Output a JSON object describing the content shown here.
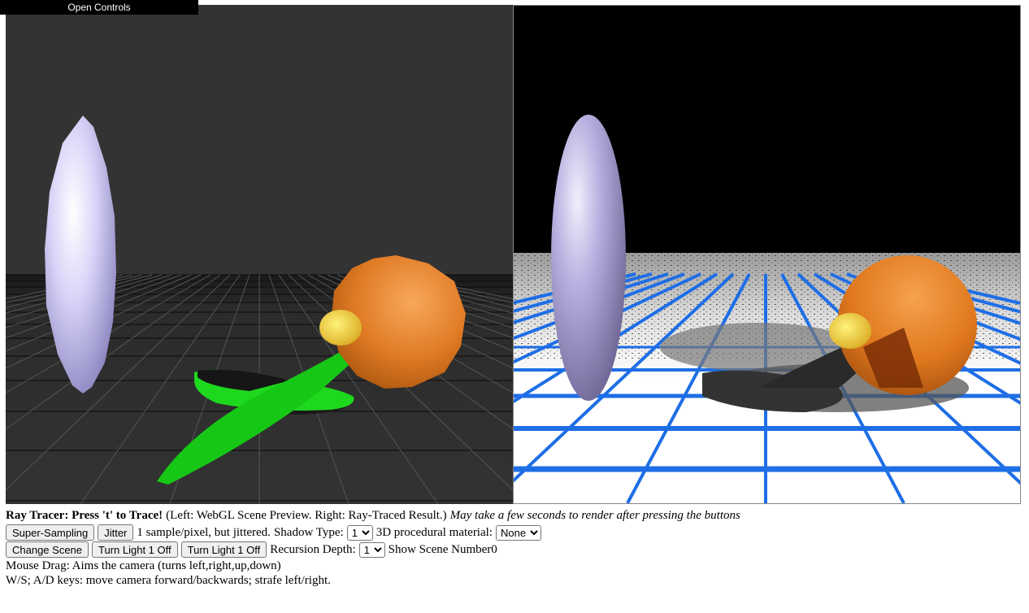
{
  "gui": {
    "open_controls_label": "Open Controls"
  },
  "header": {
    "title": "Ray Tracer: Press 't' to Trace!",
    "description": "(Left: WebGL Scene Preview. Right: Ray-Traced Result.)",
    "note": "May take a few seconds to render after pressing the buttons"
  },
  "row1": {
    "supersampling_label": "Super-Sampling",
    "jitter_label": "Jitter",
    "sampling_status": "1 sample/pixel, but jittered.",
    "shadow_label": "Shadow Type:",
    "shadow_value": "1",
    "material_label": "3D procedural material:",
    "material_value": "None"
  },
  "row2": {
    "change_scene_label": "Change Scene",
    "light1_label": "Turn Light 1 Off",
    "light2_label": "Turn Light 1 Off",
    "recursion_label": "Recursion Depth:",
    "recursion_value": "1",
    "show_scene_label": "Show Scene Number0"
  },
  "help": {
    "mouse": "Mouse Drag: Aims the camera (turns left,right,up,down)",
    "keys": "W/S; A/D keys: move camera forward/backwards; strafe left/right."
  },
  "colors": {
    "preview_bg": "#333333",
    "ellipsoid": "#c9c4f0",
    "sphere_orange": "#e8852e",
    "sphere_yellow": "#f0d24a",
    "disc_green": "#1ed81e",
    "grid_blue": "#1e6ee6"
  }
}
